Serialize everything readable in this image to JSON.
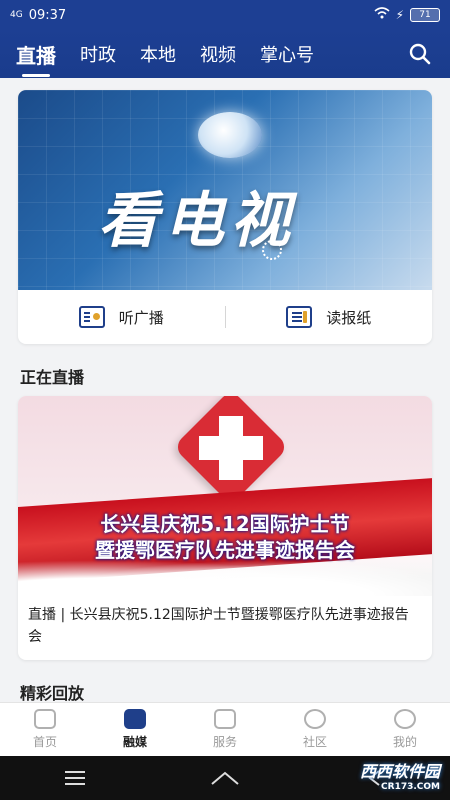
{
  "status_bar": {
    "time": "09:37",
    "network": "4G",
    "battery": "71"
  },
  "top_nav": {
    "tabs": [
      {
        "label": "直播",
        "active": true
      },
      {
        "label": "时政",
        "active": false
      },
      {
        "label": "本地",
        "active": false
      },
      {
        "label": "视频",
        "active": false
      },
      {
        "label": "掌心号",
        "active": false
      }
    ],
    "search_icon": "search-icon"
  },
  "tv_card": {
    "banner_title": "看电视",
    "actions": [
      {
        "label": "听广播",
        "icon": "radio-icon"
      },
      {
        "label": "读报纸",
        "icon": "newspaper-icon"
      }
    ]
  },
  "sections": {
    "live": "正在直播",
    "replay": "精彩回放"
  },
  "live_card": {
    "banner_lines": [
      "长兴县庆祝5.12国际护士节",
      "暨援鄂医疗队先进事迹报告会"
    ],
    "caption": "直播 | 长兴县庆祝5.12国际护士节暨援鄂医疗队先进事迹报告会"
  },
  "bottom_nav": [
    {
      "label": "首页",
      "icon": "home-icon",
      "active": false
    },
    {
      "label": "融媒",
      "icon": "media-icon",
      "active": true
    },
    {
      "label": "服务",
      "icon": "service-icon",
      "active": false
    },
    {
      "label": "社区",
      "icon": "community-icon",
      "active": false
    },
    {
      "label": "我的",
      "icon": "profile-icon",
      "active": false
    }
  ],
  "watermark": {
    "text": "西西软件园",
    "sub": "CR173.COM"
  },
  "colors": {
    "brand_blue": "#1d3f93",
    "accent_red": "#d92c35"
  }
}
